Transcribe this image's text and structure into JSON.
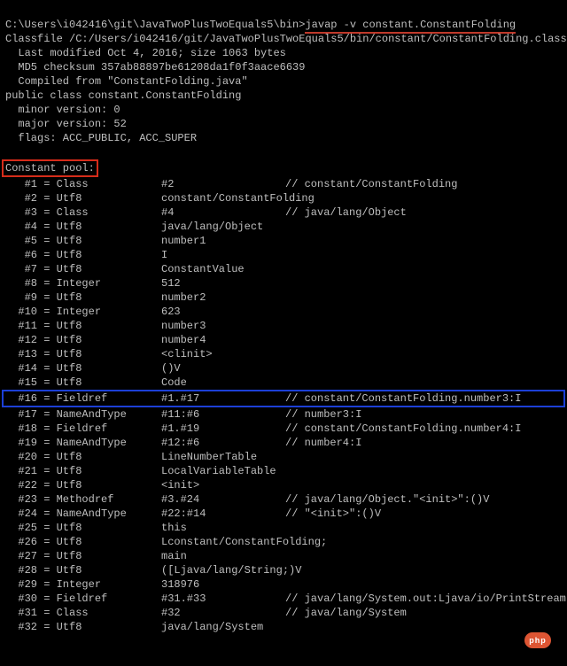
{
  "prompt": "C:\\Users\\i042416\\git\\JavaTwoPlusTwoEquals5\\bin>",
  "command": "javap -v constant.ConstantFolding",
  "header": [
    "Classfile /C:/Users/i042416/git/JavaTwoPlusTwoEquals5/bin/constant/ConstantFolding.class",
    "  Last modified Oct 4, 2016; size 1063 bytes",
    "  MD5 checksum 357ab88897be61208da1f0f3aace6639",
    "  Compiled from \"ConstantFolding.java\"",
    "public class constant.ConstantFolding",
    "  minor version: 0",
    "  major version: 52",
    "  flags: ACC_PUBLIC, ACC_SUPER"
  ],
  "pool_label": "Constant pool:",
  "pool": [
    {
      "idx": "   #1 = Class",
      "val": "#2",
      "cmt": "// constant/ConstantFolding",
      "hl": ""
    },
    {
      "idx": "   #2 = Utf8",
      "val": "constant/ConstantFolding",
      "cmt": "",
      "hl": ""
    },
    {
      "idx": "   #3 = Class",
      "val": "#4",
      "cmt": "// java/lang/Object",
      "hl": ""
    },
    {
      "idx": "   #4 = Utf8",
      "val": "java/lang/Object",
      "cmt": "",
      "hl": ""
    },
    {
      "idx": "   #5 = Utf8",
      "val": "number1",
      "cmt": "",
      "hl": ""
    },
    {
      "idx": "   #6 = Utf8",
      "val": "I",
      "cmt": "",
      "hl": ""
    },
    {
      "idx": "   #7 = Utf8",
      "val": "ConstantValue",
      "cmt": "",
      "hl": ""
    },
    {
      "idx": "   #8 = Integer",
      "val": "512",
      "cmt": "",
      "hl": ""
    },
    {
      "idx": "   #9 = Utf8",
      "val": "number2",
      "cmt": "",
      "hl": ""
    },
    {
      "idx": "  #10 = Integer",
      "val": "623",
      "cmt": "",
      "hl": ""
    },
    {
      "idx": "  #11 = Utf8",
      "val": "number3",
      "cmt": "",
      "hl": ""
    },
    {
      "idx": "  #12 = Utf8",
      "val": "number4",
      "cmt": "",
      "hl": ""
    },
    {
      "idx": "  #13 = Utf8",
      "val": "<clinit>",
      "cmt": "",
      "hl": ""
    },
    {
      "idx": "  #14 = Utf8",
      "val": "()V",
      "cmt": "",
      "hl": ""
    },
    {
      "idx": "  #15 = Utf8",
      "val": "Code",
      "cmt": "",
      "hl": ""
    },
    {
      "idx": "  #16 = Fieldref",
      "val": "#1.#17",
      "cmt": "// constant/ConstantFolding.number3:I",
      "hl": "blue"
    },
    {
      "idx": "  #17 = NameAndType",
      "val": "#11:#6",
      "cmt": "// number3:I",
      "hl": ""
    },
    {
      "idx": "  #18 = Fieldref",
      "val": "#1.#19",
      "cmt": "// constant/ConstantFolding.number4:I",
      "hl": ""
    },
    {
      "idx": "  #19 = NameAndType",
      "val": "#12:#6",
      "cmt": "// number4:I",
      "hl": ""
    },
    {
      "idx": "  #20 = Utf8",
      "val": "LineNumberTable",
      "cmt": "",
      "hl": ""
    },
    {
      "idx": "  #21 = Utf8",
      "val": "LocalVariableTable",
      "cmt": "",
      "hl": ""
    },
    {
      "idx": "  #22 = Utf8",
      "val": "<init>",
      "cmt": "",
      "hl": ""
    },
    {
      "idx": "  #23 = Methodref",
      "val": "#3.#24",
      "cmt": "// java/lang/Object.\"<init>\":()V",
      "hl": ""
    },
    {
      "idx": "  #24 = NameAndType",
      "val": "#22:#14",
      "cmt": "// \"<init>\":()V",
      "hl": ""
    },
    {
      "idx": "  #25 = Utf8",
      "val": "this",
      "cmt": "",
      "hl": ""
    },
    {
      "idx": "  #26 = Utf8",
      "val": "Lconstant/ConstantFolding;",
      "cmt": "",
      "hl": ""
    },
    {
      "idx": "  #27 = Utf8",
      "val": "main",
      "cmt": "",
      "hl": ""
    },
    {
      "idx": "  #28 = Utf8",
      "val": "([Ljava/lang/String;)V",
      "cmt": "",
      "hl": ""
    },
    {
      "idx": "  #29 = Integer",
      "val": "318976",
      "cmt": "",
      "hl": ""
    },
    {
      "idx": "  #30 = Fieldref",
      "val": "#31.#33",
      "cmt": "// java/lang/System.out:Ljava/io/PrintStream;",
      "hl": ""
    },
    {
      "idx": "  #31 = Class",
      "val": "#32",
      "cmt": "// java/lang/System",
      "hl": ""
    },
    {
      "idx": "  #32 = Utf8",
      "val": "java/lang/System",
      "cmt": "",
      "hl": ""
    }
  ],
  "watermark": "php"
}
